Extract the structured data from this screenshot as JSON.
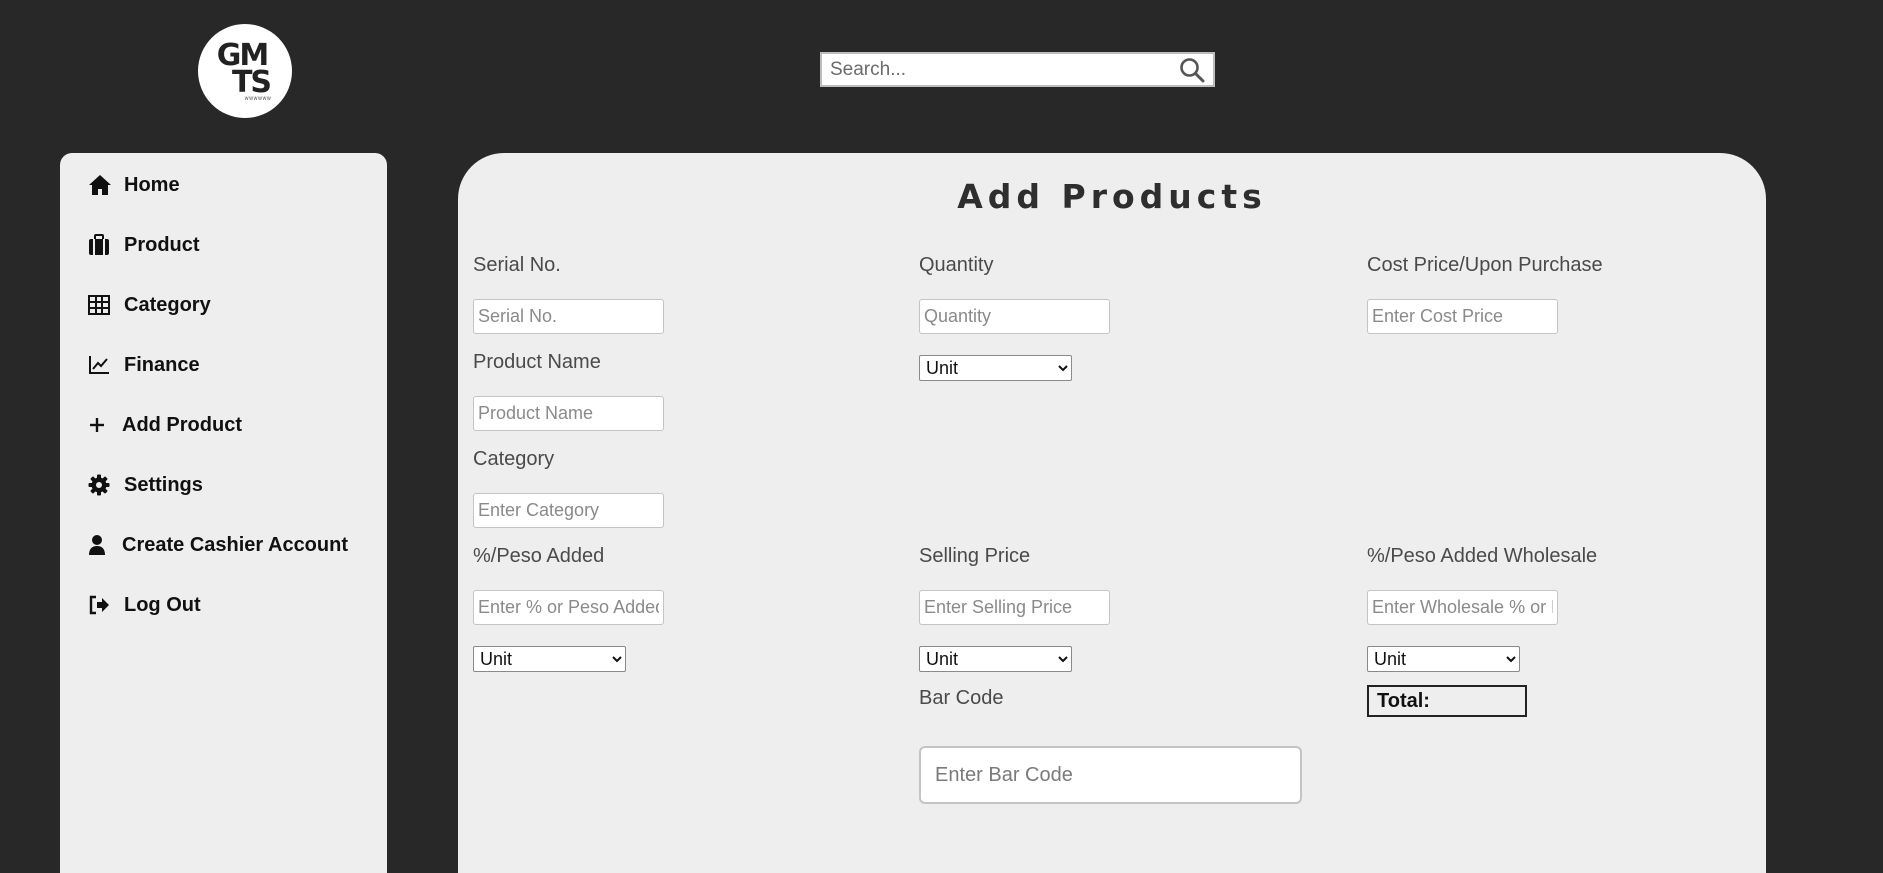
{
  "header": {
    "logo": {
      "line1": "GM",
      "line2": "TS",
      "sub": "WWWWWW"
    },
    "search": {
      "placeholder": "Search..."
    }
  },
  "sidebar": {
    "items": [
      {
        "label": "Home",
        "icon": "home-icon"
      },
      {
        "label": "Product",
        "icon": "briefcase-icon"
      },
      {
        "label": "Category",
        "icon": "table-icon"
      },
      {
        "label": "Finance",
        "icon": "chart-line-icon"
      },
      {
        "label": "Add Product",
        "icon": "plus-icon"
      },
      {
        "label": "Settings",
        "icon": "gear-icon"
      },
      {
        "label": "Create Cashier Account",
        "icon": "user-icon"
      },
      {
        "label": "Log Out",
        "icon": "logout-icon"
      }
    ]
  },
  "main": {
    "title": "Add Products",
    "serial": {
      "label": "Serial No.",
      "placeholder": "Serial No."
    },
    "product_name": {
      "label": "Product Name",
      "placeholder": "Product Name"
    },
    "category": {
      "label": "Category",
      "placeholder": "Enter Category"
    },
    "quantity": {
      "label": "Quantity",
      "placeholder": "Quantity",
      "unit": "Unit"
    },
    "cost_price": {
      "label": "Cost Price/Upon Purchase",
      "placeholder": "Enter Cost Price"
    },
    "peso_added": {
      "label": "%/Peso Added",
      "placeholder": "Enter % or Peso Added",
      "unit": "Unit"
    },
    "selling_price": {
      "label": "Selling Price",
      "placeholder": "Enter Selling Price",
      "unit": "Unit"
    },
    "wholesale": {
      "label": "%/Peso Added Wholesale",
      "placeholder": "Enter Wholesale % or Peso",
      "unit": "Unit"
    },
    "total": {
      "label": "Total:"
    },
    "barcode": {
      "label": "Bar Code",
      "placeholder": "Enter Bar Code"
    }
  },
  "colors": {
    "background": "#282828",
    "panel": "#eeeeee",
    "text": "#111111"
  }
}
